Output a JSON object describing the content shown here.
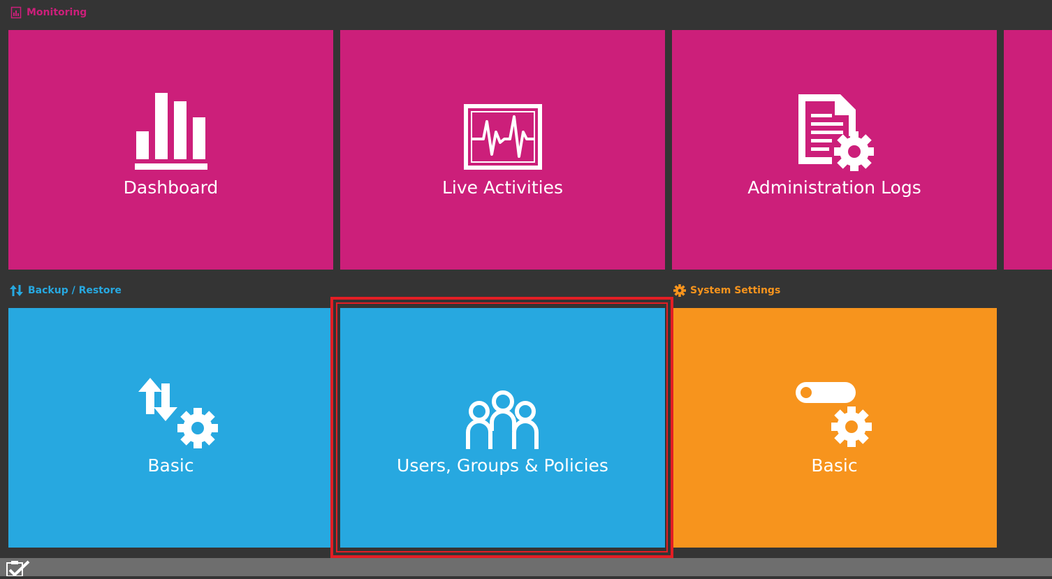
{
  "colors": {
    "background": "#343434",
    "monitoring": "#cc1f7a",
    "backup": "#27a8e0",
    "system": "#f7941d",
    "highlight": "#e31e24",
    "bottom_bar": "#6e6e6e"
  },
  "sections": {
    "monitoring": {
      "label": "Monitoring",
      "icon": "report-icon"
    },
    "backup": {
      "label": "Backup / Restore",
      "icon": "up-down-arrows-icon"
    },
    "system": {
      "label": "System Settings",
      "icon": "gear-icon"
    }
  },
  "tiles": {
    "dashboard": {
      "label": "Dashboard",
      "icon": "bar-chart-icon"
    },
    "live_activities": {
      "label": "Live Activities",
      "icon": "pulse-monitor-icon"
    },
    "administration_logs": {
      "label": "Administration Logs",
      "icon": "document-gear-icon"
    },
    "backup_basic": {
      "label": "Basic",
      "icon": "arrows-gear-icon"
    },
    "users_groups_policies": {
      "label": "Users, Groups & Policies",
      "icon": "users-group-icon",
      "highlighted": true
    },
    "system_basic": {
      "label": "Basic",
      "icon": "toggle-gear-icon"
    }
  },
  "bottom_bar": {
    "icon": "checklist-icon"
  }
}
